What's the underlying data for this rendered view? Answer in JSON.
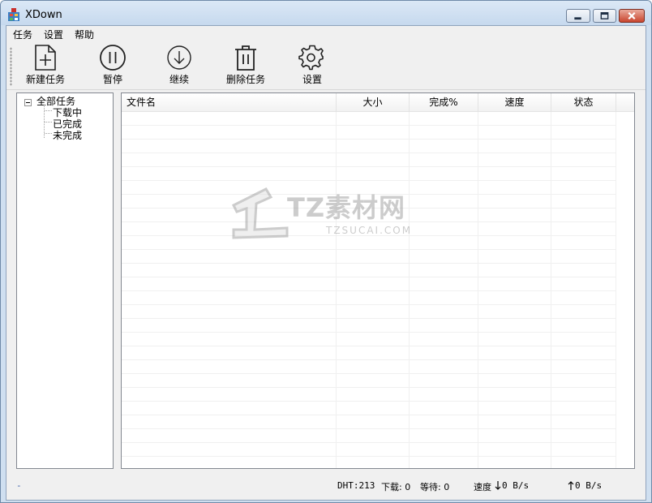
{
  "window": {
    "title": "XDown"
  },
  "menu": [
    {
      "label": "任务"
    },
    {
      "label": "设置"
    },
    {
      "label": "帮助"
    }
  ],
  "toolbar": {
    "new_task": "新建任务",
    "pause": "暂停",
    "resume": "继续",
    "delete_task": "删除任务",
    "settings": "设置"
  },
  "tree": {
    "root": "全部任务",
    "children": [
      "下载中",
      "已完成",
      "未完成"
    ]
  },
  "list": {
    "columns": [
      "文件名",
      "大小",
      "完成%",
      "速度",
      "状态"
    ],
    "rows": []
  },
  "watermark": {
    "text": "TZ素材网",
    "sub": "TZSUCAI.COM"
  },
  "status": {
    "left": "-",
    "dht": "DHT:213",
    "downloading": "下载: 0",
    "waiting": "等待: 0",
    "speed_down_label": "速度",
    "speed_down": "0 B/s",
    "speed_up": "0 B/s"
  },
  "icons": {
    "app": "app-icon",
    "minimize": "minimize-icon",
    "maximize": "maximize-icon",
    "close": "close-icon",
    "new_task": "new-file-icon",
    "pause": "pause-icon",
    "resume": "download-arrow-icon",
    "delete": "trash-icon",
    "settings": "gear-icon"
  }
}
